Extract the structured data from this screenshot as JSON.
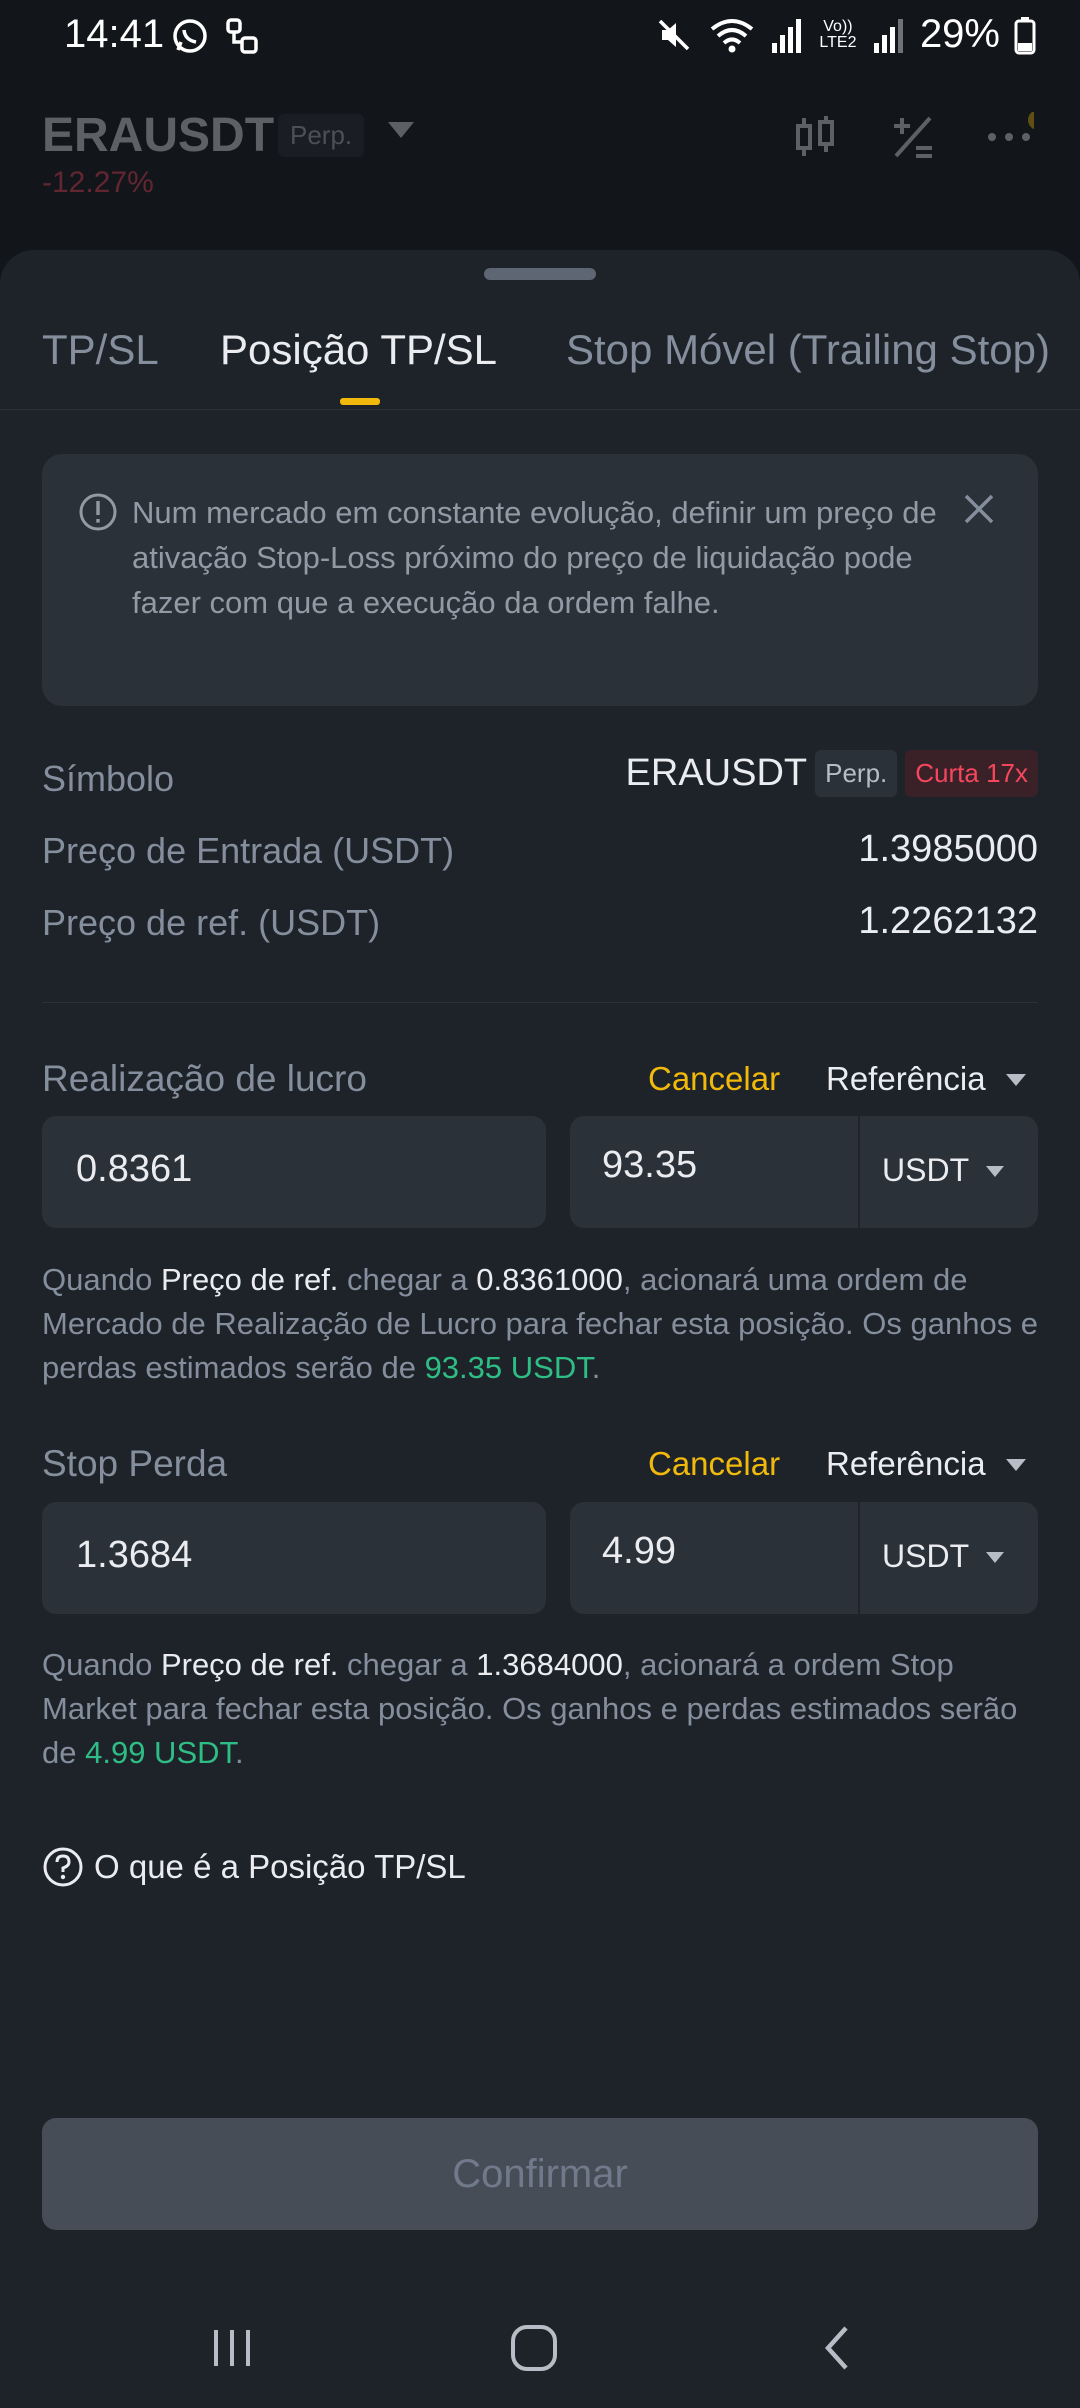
{
  "status_bar": {
    "time": "14:41",
    "battery": "29%",
    "icons": [
      "whatsapp-icon",
      "usb-icon",
      "mute-icon",
      "wifi-icon",
      "signal-icon",
      "volte-icon",
      "signal-icon",
      "battery-icon"
    ],
    "volte_text": "Vo)) LTE2"
  },
  "background_header": {
    "symbol": "ERAUSDT",
    "perp": "Perp.",
    "change": "-12.27%"
  },
  "tabs": [
    {
      "label": "TP/SL",
      "active": false
    },
    {
      "label": "Posição TP/SL",
      "active": true
    },
    {
      "label": "Stop Móvel (Trailing Stop)",
      "active": false
    }
  ],
  "notice": {
    "text": "Num mercado em constante evolução, definir um preço de ativação Stop-Loss próximo do preço de liquidação pode fazer com que a execução da ordem falhe."
  },
  "info": {
    "symbol_label": "Símbolo",
    "symbol_value": "ERAUSDT",
    "perp_tag": "Perp.",
    "side_tag": "Curta 17x",
    "entry_label": "Preço de Entrada (USDT)",
    "entry_value": "1.3985000",
    "ref_label": "Preço de ref. (USDT)",
    "ref_value": "1.2262132"
  },
  "take_profit": {
    "title": "Realização de lucro",
    "cancel": "Cancelar",
    "reference": "Referência",
    "price": "0.8361",
    "amount": "93.35",
    "unit": "USDT",
    "desc": {
      "p1": "Quando ",
      "ref": "Preço de ref.",
      "p2": " chegar a ",
      "price": "0.8361000",
      "p3": ", acionará uma ordem de Mercado de Realização de Lucro para fechar esta posição. Os ganhos e perdas estimados serão de ",
      "pnl": "93.35 USDT",
      "p4": "."
    }
  },
  "stop_loss": {
    "title": "Stop Perda",
    "cancel": "Cancelar",
    "reference": "Referência",
    "price": "1.3684",
    "amount": "4.99",
    "unit": "USDT",
    "desc": {
      "p1": "Quando ",
      "ref": "Preço de ref.",
      "p2": " chegar a ",
      "price": "1.3684000",
      "p3": ", acionará a ordem Stop Market para fechar esta posição. Os ganhos e perdas estimados serão de ",
      "pnl": "4.99 USDT",
      "p4": "."
    }
  },
  "help": {
    "label": "O que é a Posição TP/SL"
  },
  "confirm": {
    "label": "Confirmar"
  },
  "colors": {
    "accent": "#f0b90b",
    "positive": "#2ebd85",
    "negative": "#f6465d"
  }
}
